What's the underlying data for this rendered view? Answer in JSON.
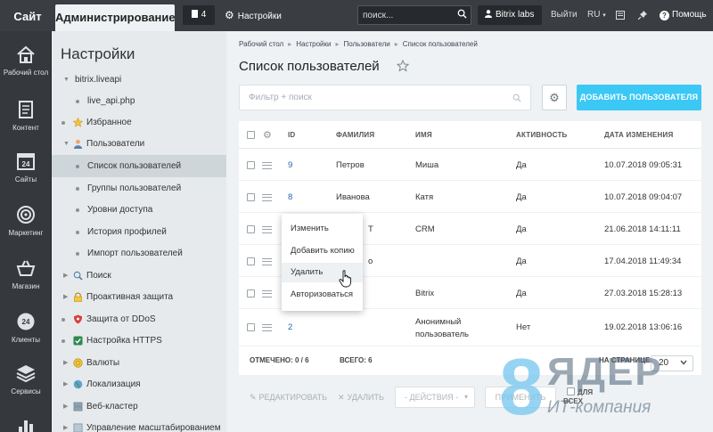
{
  "topbar": {
    "site": "Сайт",
    "admin": "Администрирование",
    "notifications": "4",
    "settings": "Настройки",
    "search_placeholder": "поиск...",
    "user": "Bitrix labs",
    "logout": "Выйти",
    "lang": "RU",
    "help": "Помощь"
  },
  "rail": [
    {
      "label": "Рабочий стол",
      "icon": "home-icon"
    },
    {
      "label": "Контент",
      "icon": "document-icon"
    },
    {
      "label": "Сайты",
      "icon": "calendar-icon"
    },
    {
      "label": "Маркетинг",
      "icon": "target-icon"
    },
    {
      "label": "Магазин",
      "icon": "basket-icon"
    },
    {
      "label": "Клиенты",
      "icon": "clients-icon"
    },
    {
      "label": "Сервисы",
      "icon": "layers-icon"
    }
  ],
  "rail_calendar_day": "24",
  "menu": {
    "title": "Настройки",
    "items": [
      {
        "label": "bitrix.liveapi"
      },
      {
        "label": "live_api.php"
      },
      {
        "label": "Избранное"
      },
      {
        "label": "Пользователи"
      },
      {
        "label": "Список пользователей"
      },
      {
        "label": "Группы пользователей"
      },
      {
        "label": "Уровни доступа"
      },
      {
        "label": "История профилей"
      },
      {
        "label": "Импорт пользователей"
      },
      {
        "label": "Поиск"
      },
      {
        "label": "Проактивная защита"
      },
      {
        "label": "Защита от DDoS"
      },
      {
        "label": "Настройка HTTPS"
      },
      {
        "label": "Валюты"
      },
      {
        "label": "Локализация"
      },
      {
        "label": "Веб-кластер"
      },
      {
        "label": "Управление масштабированием"
      }
    ]
  },
  "breadcrumb": [
    "Рабочий стол",
    "Настройки",
    "Пользователи",
    "Список пользователей"
  ],
  "page_title": "Список пользователей",
  "filter": {
    "placeholder": "Фильтр + поиск"
  },
  "add_button": "ДОБАВИТЬ ПОЛЬЗОВАТЕЛЯ",
  "table": {
    "headers": [
      "ID",
      "ФАМИЛИЯ",
      "ИМЯ",
      "АКТИВНОСТЬ",
      "ДАТА ИЗМЕНЕНИЯ"
    ],
    "rows": [
      {
        "id": "9",
        "surname": "Петров",
        "name": "Миша",
        "active": "Да",
        "date": "10.07.2018 09:05:31"
      },
      {
        "id": "8",
        "surname": "Иванова",
        "name": "Катя",
        "active": "Да",
        "date": "10.07.2018 09:04:07"
      },
      {
        "id": "",
        "surname": "Т",
        "name": "CRM",
        "active": "Да",
        "date": "21.06.2018 14:11:11"
      },
      {
        "id": "",
        "surname": "о",
        "name": "",
        "active": "Да",
        "date": "17.04.2018 11:49:34"
      },
      {
        "id": "",
        "surname": "",
        "name": "Bitrix",
        "active": "Да",
        "date": "27.03.2018 15:28:13"
      },
      {
        "id": "2",
        "surname": "",
        "name": "Анонимный пользователь",
        "active": "Нет",
        "date": "19.02.2018 13:06:16"
      }
    ],
    "footer": {
      "selected": "ОТМЕЧЕНО: 0 / 6",
      "total": "ВСЕГО: 6",
      "per_page_label": "НА СТРАНИЦЕ:",
      "per_page_value": "20"
    }
  },
  "actions": {
    "edit": "РЕДАКТИРОВАТЬ",
    "delete": "УДАЛИТЬ",
    "select": "- ДЕЙСТВИЯ -",
    "apply": "ПРИМЕНИТЬ",
    "for_all": "ДЛЯ ВСЕХ"
  },
  "context_menu": [
    "Изменить",
    "Добавить копию",
    "Удалить",
    "Авторизоваться"
  ],
  "watermark": {
    "digit": "8",
    "word": "ЯДЕР",
    "sub": "ИТ-компания"
  },
  "colors": {
    "accent": "#3bc8f5",
    "link": "#2067b0",
    "topbar": "#3a3d42",
    "rail": "#35393e"
  }
}
